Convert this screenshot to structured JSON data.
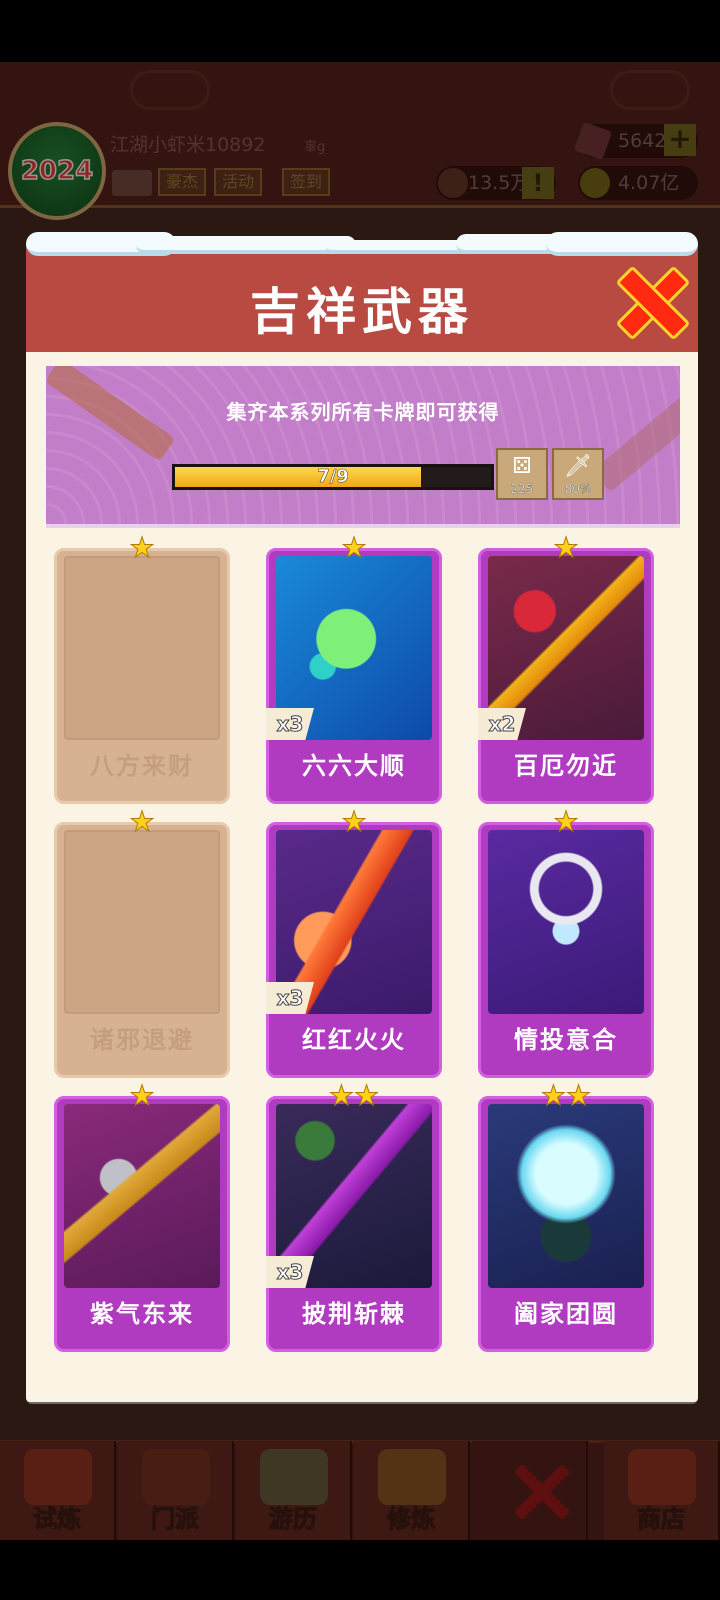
{
  "header": {
    "year_badge": "2024",
    "player_name": "江湖小虾米10892",
    "player_tag": "辜g",
    "chips": [
      "豪杰",
      "活动",
      "签到"
    ],
    "gems": "5642",
    "power": "13.5万",
    "coins": "4.07亿"
  },
  "modal": {
    "title": "吉祥武器",
    "banner_text": "集齐本系列所有卡牌即可获得",
    "progress_text": "7/9",
    "progress_fraction": 0.78,
    "rewards": [
      {
        "icon": "dice-icon",
        "count": "225"
      },
      {
        "icon": "sword-scroll-icon",
        "count": "80%"
      }
    ],
    "cards": [
      {
        "label": "八方来财",
        "stars": "★",
        "locked": true,
        "mult": ""
      },
      {
        "label": "六六大顺",
        "stars": "★",
        "locked": false,
        "mult": "x3"
      },
      {
        "label": "百厄勿近",
        "stars": "★",
        "locked": false,
        "mult": "x2"
      },
      {
        "label": "诸邪退避",
        "stars": "★",
        "locked": true,
        "mult": ""
      },
      {
        "label": "红红火火",
        "stars": "★",
        "locked": false,
        "mult": "x3"
      },
      {
        "label": "情投意合",
        "stars": "★",
        "locked": false,
        "mult": ""
      },
      {
        "label": "紫气东来",
        "stars": "★",
        "locked": false,
        "mult": ""
      },
      {
        "label": "披荆斩棘",
        "stars": "★★",
        "locked": false,
        "mult": "x3"
      },
      {
        "label": "阖家团圆",
        "stars": "★★",
        "locked": false,
        "mult": ""
      }
    ]
  },
  "nav": {
    "tabs": [
      "试炼",
      "门派",
      "游历",
      "修炼",
      "商店"
    ]
  },
  "colors": {
    "accent": "#b03ac0",
    "header_red": "#b94a42",
    "gold": "#ffd21a"
  }
}
